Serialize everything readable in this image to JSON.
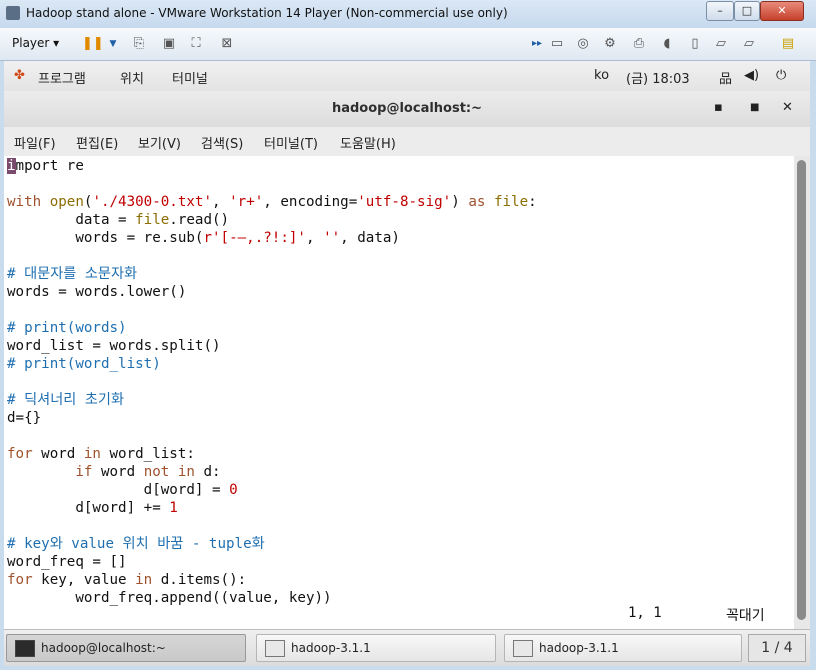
{
  "vmware": {
    "title": "Hadoop stand alone - VMware Workstation 14 Player (Non-commercial use only)",
    "min_glyph": "–",
    "max_glyph": "□",
    "close_glyph": "✕",
    "player_label": "Player ▾"
  },
  "panel": {
    "apps": "프로그램",
    "places": "위치",
    "terminal": "터미널",
    "input_method": "ko",
    "clock": "(금) 18:03"
  },
  "terminal": {
    "title": "hadoop@localhost:~",
    "menu": [
      "파일(F)",
      "편집(E)",
      "보기(V)",
      "검색(S)",
      "터미널(T)",
      "도움말(H)"
    ]
  },
  "editor": {
    "cursor_char": "i",
    "line1_rest": "mport re",
    "with": "with",
    "open": "open",
    "open_paren": "(",
    "filename_str": "'./4300-0.txt'",
    "comma_sp": ", ",
    "mode_str": "'r+'",
    "enc_kw": ", encoding=",
    "enc_str": "'utf-8-sig'",
    "close_paren": ")",
    "as": " as ",
    "file": "file",
    "colon": ":",
    "data_eq": "        data = ",
    "file_read": "file",
    "read_call": ".read()",
    "words_eq": "        words = re.sub(",
    "regex_str": "r'[-—,.?!:]'",
    "comma2": ", ",
    "empty_str": "''",
    "sub_tail": ", data)",
    "comment1": "# 대문자를 소문자화",
    "lower_line": "words = words.lower()",
    "comment2": "# print(words)",
    "split_line": "word_list = words.split()",
    "comment3": "# print(word_list)",
    "comment4": "# 딕셔너리 초기화",
    "dict_line": "d={}",
    "for": "for",
    "for_mid": " word ",
    "in": "in",
    "for_tail": " word_list:",
    "if_indent": "        ",
    "if": "if",
    "if_mid": " word ",
    "not": "not",
    "in2": "in",
    "if_tail": " d:",
    "assign_lhs": "                d[word] = ",
    "zero": "0",
    "incr_lhs": "        d[word] += ",
    "one": "1",
    "comment5": "# key와 value 위치 바꿈 - tuple화",
    "freq_line": "word_freq = []",
    "for2": "for",
    "for2_mid": " key, value ",
    "in3": "in",
    "for2_tail": " d.items():",
    "append_line": "        word_freq.append((value, key))",
    "position": "1, 1",
    "percent": "꼭대기"
  },
  "taskbar": {
    "items": [
      "hadoop@localhost:~",
      "hadoop-3.1.1",
      "hadoop-3.1.1"
    ],
    "pager": "1 / 4"
  }
}
